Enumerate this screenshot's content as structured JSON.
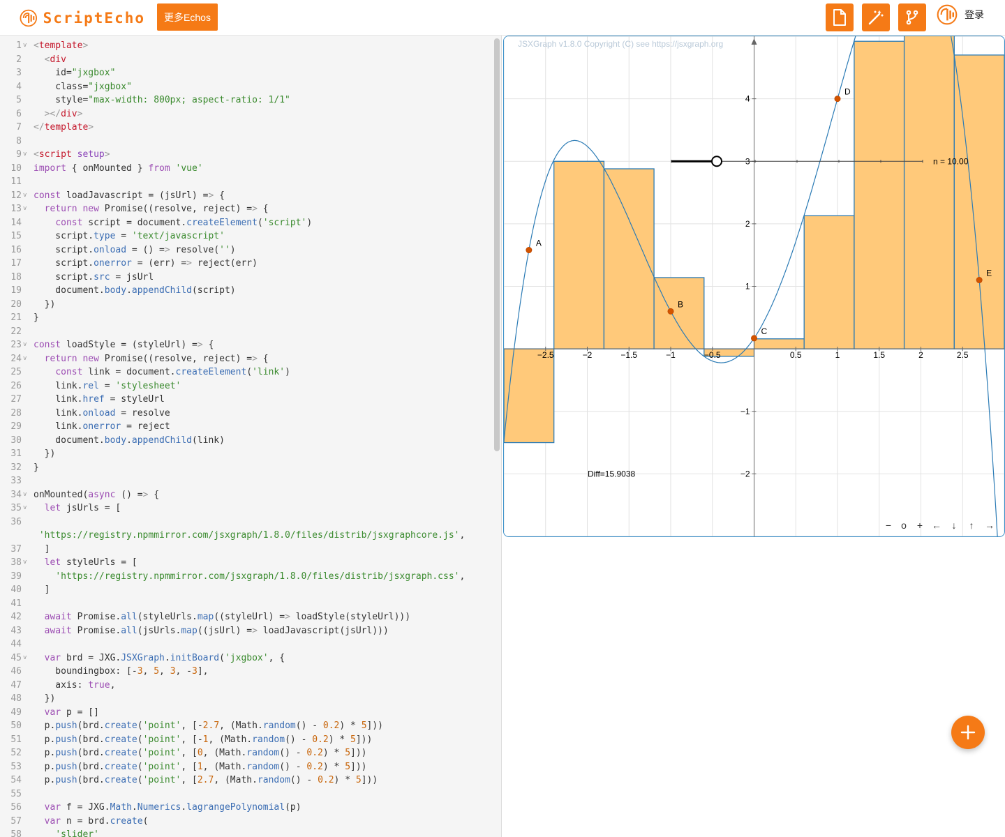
{
  "header": {
    "brand": "ScriptEcho",
    "more_button": "更多Echos",
    "login": "登录",
    "accent": "#f57a16"
  },
  "editor": {
    "lines": [
      {
        "n": "1",
        "fold": true,
        "code": "<template>"
      },
      {
        "n": "2",
        "code": "  <div"
      },
      {
        "n": "3",
        "code": "    id=\"jxgbox\""
      },
      {
        "n": "4",
        "code": "    class=\"jxgbox\""
      },
      {
        "n": "5",
        "code": "    style=\"max-width: 800px; aspect-ratio: 1/1\""
      },
      {
        "n": "6",
        "code": "  ></div>"
      },
      {
        "n": "7",
        "code": "</template>"
      },
      {
        "n": "8",
        "code": ""
      },
      {
        "n": "9",
        "fold": true,
        "code": "<script setup>"
      },
      {
        "n": "10",
        "code": "import { onMounted } from 'vue'"
      },
      {
        "n": "11",
        "code": ""
      },
      {
        "n": "12",
        "fold": true,
        "code": "const loadJavascript = (jsUrl) => {"
      },
      {
        "n": "13",
        "fold": true,
        "code": "  return new Promise((resolve, reject) => {"
      },
      {
        "n": "14",
        "code": "    const script = document.createElement('script')"
      },
      {
        "n": "15",
        "code": "    script.type = 'text/javascript'"
      },
      {
        "n": "16",
        "code": "    script.onload = () => resolve('')"
      },
      {
        "n": "17",
        "code": "    script.onerror = (err) => reject(err)"
      },
      {
        "n": "18",
        "code": "    script.src = jsUrl"
      },
      {
        "n": "19",
        "code": "    document.body.appendChild(script)"
      },
      {
        "n": "20",
        "code": "  })"
      },
      {
        "n": "21",
        "code": "}"
      },
      {
        "n": "22",
        "code": ""
      },
      {
        "n": "23",
        "fold": true,
        "code": "const loadStyle = (styleUrl) => {"
      },
      {
        "n": "24",
        "fold": true,
        "code": "  return new Promise((resolve, reject) => {"
      },
      {
        "n": "25",
        "code": "    const link = document.createElement('link')"
      },
      {
        "n": "26",
        "code": "    link.rel = 'stylesheet'"
      },
      {
        "n": "27",
        "code": "    link.href = styleUrl"
      },
      {
        "n": "28",
        "code": "    link.onload = resolve"
      },
      {
        "n": "29",
        "code": "    link.onerror = reject"
      },
      {
        "n": "30",
        "code": "    document.body.appendChild(link)"
      },
      {
        "n": "31",
        "code": "  })"
      },
      {
        "n": "32",
        "code": "}"
      },
      {
        "n": "33",
        "code": ""
      },
      {
        "n": "34",
        "fold": true,
        "code": "onMounted(async () => {"
      },
      {
        "n": "35",
        "fold": true,
        "code": "  let jsUrls = ["
      },
      {
        "n": "36",
        "code": ""
      },
      {
        "n": "",
        "code": " 'https://registry.npmmirror.com/jsxgraph/1.8.0/files/distrib/jsxgraphcore.js',"
      },
      {
        "n": "37",
        "code": "  ]"
      },
      {
        "n": "38",
        "fold": true,
        "code": "  let styleUrls = ["
      },
      {
        "n": "39",
        "code": "    'https://registry.npmmirror.com/jsxgraph/1.8.0/files/distrib/jsxgraph.css',"
      },
      {
        "n": "40",
        "code": "  ]"
      },
      {
        "n": "41",
        "code": ""
      },
      {
        "n": "42",
        "code": "  await Promise.all(styleUrls.map((styleUrl) => loadStyle(styleUrl)))"
      },
      {
        "n": "43",
        "code": "  await Promise.all(jsUrls.map((jsUrl) => loadJavascript(jsUrl)))"
      },
      {
        "n": "44",
        "code": ""
      },
      {
        "n": "45",
        "fold": true,
        "code": "  var brd = JXG.JSXGraph.initBoard('jxgbox', {"
      },
      {
        "n": "46",
        "code": "    boundingbox: [-3, 5, 3, -3],"
      },
      {
        "n": "47",
        "code": "    axis: true,"
      },
      {
        "n": "48",
        "code": "  })"
      },
      {
        "n": "49",
        "code": "  var p = []"
      },
      {
        "n": "50",
        "code": "  p.push(brd.create('point', [-2.7, (Math.random() - 0.2) * 5]))"
      },
      {
        "n": "51",
        "code": "  p.push(brd.create('point', [-1, (Math.random() - 0.2) * 5]))"
      },
      {
        "n": "52",
        "code": "  p.push(brd.create('point', [0, (Math.random() - 0.2) * 5]))"
      },
      {
        "n": "53",
        "code": "  p.push(brd.create('point', [1, (Math.random() - 0.2) * 5]))"
      },
      {
        "n": "54",
        "code": "  p.push(brd.create('point', [2.7, (Math.random() - 0.2) * 5]))"
      },
      {
        "n": "55",
        "code": ""
      },
      {
        "n": "56",
        "code": "  var f = JXG.Math.Numerics.lagrangePolynomial(p)"
      },
      {
        "n": "57",
        "code": "  var n = brd.create("
      },
      {
        "n": "58",
        "code": "    'slider'"
      }
    ]
  },
  "board": {
    "copyright": "JSXGraph v1.8.0 Copyright (C) see https://jsxgraph.org",
    "slider_label": "n = 10.00",
    "diff_label": "Diff=15.9038",
    "x_ticks": [
      "−2.5",
      "−2",
      "−1.5",
      "−1",
      "−0.5",
      "0.5",
      "1",
      "1.5",
      "2",
      "2.5"
    ],
    "x_tick_values": [
      -2.5,
      -2,
      -1.5,
      -1,
      -0.5,
      0.5,
      1,
      1.5,
      2,
      2.5
    ],
    "y_ticks": [
      "4",
      "3",
      "2",
      "1",
      "−1",
      "−2"
    ],
    "y_tick_values": [
      4,
      3,
      2,
      1,
      -1,
      -2
    ],
    "points": [
      {
        "name": "A",
        "x": -2.7,
        "y": 1.58
      },
      {
        "name": "B",
        "x": -1,
        "y": 0.6
      },
      {
        "name": "C",
        "x": 0,
        "y": 0.17
      },
      {
        "name": "D",
        "x": 1,
        "y": 4.0
      },
      {
        "name": "E",
        "x": 2.7,
        "y": 1.1
      }
    ],
    "bars": [
      {
        "x0": -3,
        "x1": -2.4,
        "h": -1.5
      },
      {
        "x0": -2.4,
        "x1": -1.8,
        "h": 3.0
      },
      {
        "x0": -1.8,
        "x1": -1.2,
        "h": 2.88
      },
      {
        "x0": -1.2,
        "x1": -0.6,
        "h": 1.14
      },
      {
        "x0": -0.6,
        "x1": 0,
        "h": -0.12
      },
      {
        "x0": 0,
        "x1": 0.6,
        "h": 0.16
      },
      {
        "x0": 0.6,
        "x1": 1.2,
        "h": 2.13
      },
      {
        "x0": 1.2,
        "x1": 1.8,
        "h": 4.92
      },
      {
        "x0": 1.8,
        "x1": 2.4,
        "h": 5.2
      },
      {
        "x0": 2.4,
        "x1": 3,
        "h": 4.7
      }
    ],
    "nav": [
      "−",
      "o",
      "+",
      "←",
      "↓",
      "↑",
      "→"
    ],
    "bar_fill": "#ffc97a",
    "bar_stroke": "#2b7bb5",
    "curve": "#2b7bb5",
    "point_color": "#d35400"
  }
}
